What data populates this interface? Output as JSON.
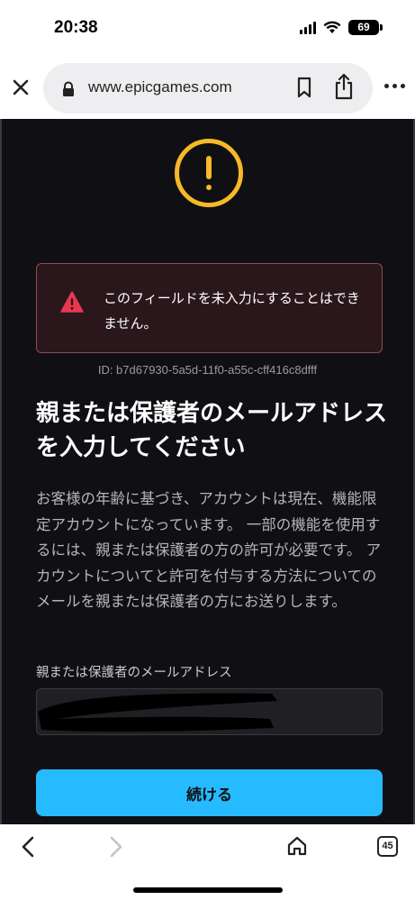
{
  "status_bar": {
    "time": "20:38",
    "battery": "69"
  },
  "browser": {
    "url": "www.epicgames.com",
    "tab_count": "45"
  },
  "error_banner": {
    "message": "このフィールドを未入力にすることはできません。"
  },
  "request_id": "ID: b7d67930-5a5d-11f0-a55c-cff416c8dfff",
  "page": {
    "title": "親または保護者のメールアドレスを入力してください",
    "description": "お客様の年齢に基づき、アカウントは現在、機能限定アカウントになっています。 一部の機能を使用するには、親または保護者の方の許可が必要です。 アカウントについてと許可を付与する方法についてのメールを親または保護者の方にお送りします。",
    "email_label": "親または保護者のメールアドレス",
    "email_value": "",
    "continue_label": "続ける"
  },
  "colors": {
    "background": "#101014",
    "warning": "#f7b928",
    "error": "#e8384f",
    "accent": "#26bbff"
  },
  "icons": {
    "close": "close-icon",
    "lock": "lock-icon",
    "bookmark": "bookmark-icon",
    "share": "share-icon",
    "more": "more-icon",
    "warning": "warning-circle-icon",
    "error": "error-triangle-icon",
    "back": "back-icon",
    "forward": "forward-icon",
    "home": "home-icon"
  }
}
